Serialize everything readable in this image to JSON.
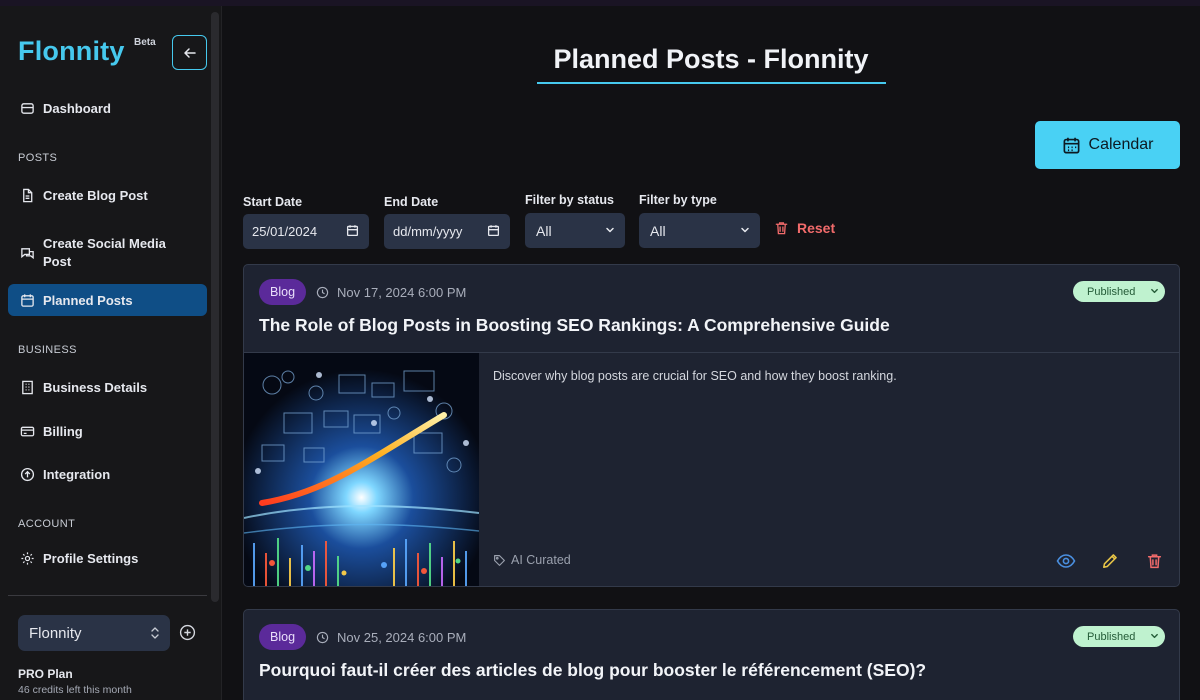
{
  "sidebar": {
    "brand": "Flonnity",
    "beta": "Beta",
    "dashboard": "Dashboard",
    "sections": {
      "posts": "POSTS",
      "business": "BUSINESS",
      "account": "ACCOUNT"
    },
    "create_blog": "Create Blog Post",
    "create_social": "Create Social Media Post",
    "planned_posts": "Planned Posts",
    "business_details": "Business Details",
    "billing": "Billing",
    "integration": "Integration",
    "profile_settings": "Profile Settings",
    "workspace": "Flonnity",
    "plan_name": "PRO Plan",
    "plan_credits": "46 credits left this month"
  },
  "header": {
    "title": "Planned Posts - Flonnity",
    "calendar_label": "Calendar"
  },
  "filters": {
    "start_label": "Start Date",
    "start_value": "25/01/2024",
    "end_label": "End Date",
    "end_value": "dd/mm/yyyy",
    "status_label": "Filter by status",
    "status_value": "All",
    "type_label": "Filter by type",
    "type_value": "All",
    "reset_label": "Reset"
  },
  "posts": [
    {
      "type": "Blog",
      "datetime": "Nov 17, 2024 6:00 PM",
      "status": "Published",
      "title": "The Role of Blog Posts in Boosting SEO Rankings: A Comprehensive Guide",
      "excerpt": "Discover why blog posts are crucial for SEO and how they boost ranking.",
      "tag": "AI Curated"
    },
    {
      "type": "Blog",
      "datetime": "Nov 25, 2024 6:00 PM",
      "status": "Published",
      "title": "Pourquoi faut-il créer des articles de blog pour booster le référencement (SEO)?"
    }
  ],
  "colors": {
    "accent": "#46c9ee",
    "active_nav": "#0f4e86",
    "badge": "#5b2a9a",
    "published": "#bff2cf",
    "danger": "#f26b6b",
    "edit": "#e8c547",
    "view": "#4a8fe0"
  }
}
